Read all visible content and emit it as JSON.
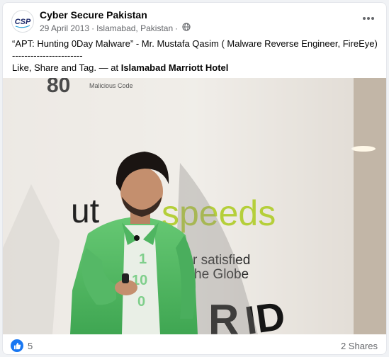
{
  "post": {
    "page_name": "Cyber Secure Pakistan",
    "date": "29 April 2013",
    "location": "Islamabad, Pakistan",
    "separator": "·",
    "avatar_text": "CSP",
    "text_line1": "“APT: Hunting 0Day Malware” - Mr. Mustafa Qasim ( Malware Reverse Engineer, FireEye)",
    "text_line2": "-----------------------",
    "text_line3_prefix": "Like, Share and Tag. — at ",
    "text_line3_place": "Islamabad Marriott Hotel"
  },
  "photo": {
    "banner_number": "80",
    "banner_caption": "Malicious Code",
    "logo_left": "ut",
    "logo_right": "speeds",
    "tagline_1": "r satisfied",
    "tagline_2": "he Globe",
    "shirt_text_1": "1",
    "shirt_text_2": "10",
    "shirt_text_3": "0",
    "bottom_letters_1": "R",
    "bottom_letters_2": "ID"
  },
  "footer": {
    "like_count": "5",
    "shares": "2 Shares"
  },
  "colors": {
    "like_blue": "#1877f2",
    "shirt_green": "#5cc06a",
    "secondary_text": "#65676b"
  },
  "icons": {
    "more": "more-horizontal-icon",
    "globe": "globe-icon",
    "like": "like-icon"
  }
}
